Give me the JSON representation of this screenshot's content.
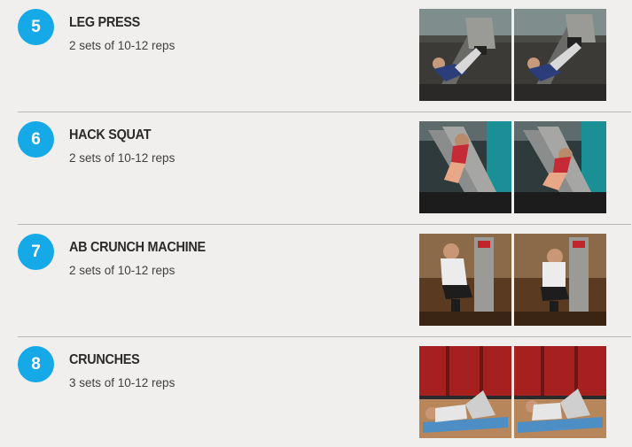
{
  "exercises": [
    {
      "number": "5",
      "name": "LEG PRESS",
      "sets": "2 sets of 10-12 reps"
    },
    {
      "number": "6",
      "name": "HACK SQUAT",
      "sets": "2 sets of 10-12 reps"
    },
    {
      "number": "7",
      "name": "AB CRUNCH MACHINE",
      "sets": "2 sets of 10-12 reps"
    },
    {
      "number": "8",
      "name": "CRUNCHES",
      "sets": "3 sets of 10-12 reps"
    }
  ],
  "colors": {
    "accent": "#15a9e8",
    "background": "#f1efed",
    "divider": "#b9b6b3"
  }
}
